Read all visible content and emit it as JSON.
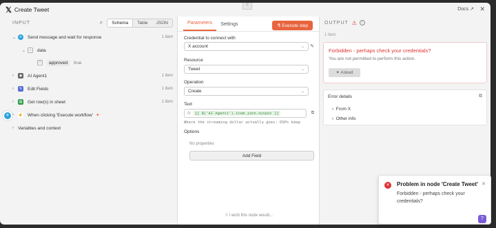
{
  "window": {
    "title": "Create Tweet",
    "docs_label": "Docs ↗",
    "close_icon": "close-icon",
    "drag_handle": "⠿"
  },
  "input": {
    "label": "INPUT",
    "views": [
      "Schema",
      "Table",
      "JSON"
    ],
    "active_view": "Schema",
    "tree": [
      {
        "label": "Send message and wait for response",
        "count": "1 item",
        "color": "#2aa3e0",
        "glyph": "✈"
      },
      {
        "label": "data",
        "color": "#888"
      },
      {
        "label": "approved",
        "value": "true"
      },
      {
        "label": "AI Agent1",
        "count": "1 item",
        "color": "#666",
        "glyph": "◉"
      },
      {
        "label": "Edit Fields",
        "count": "1 item",
        "color": "#5a6fd6",
        "glyph": "✎"
      },
      {
        "label": "Get row(s) in sheet",
        "count": "1 item",
        "color": "#2a9d4a",
        "glyph": "▤"
      },
      {
        "label": "When clicking 'Execute workflow'",
        "extra": "✦"
      },
      {
        "label": "Variables and context"
      }
    ]
  },
  "params": {
    "tabs": [
      "Parameters",
      "Settings"
    ],
    "execute_label": "Execute step",
    "credential_label": "Credential to connect with",
    "credential_value": "X account",
    "resource_label": "Resource",
    "resource_value": "Tweet",
    "operation_label": "Operation",
    "operation_value": "Create",
    "text_label": "Text",
    "text_expr": "{{ $('AI Agent1').item.json.output }}",
    "text_preview": "Where the streaming dollar actually goes: DSPs keep",
    "options_label": "Options",
    "no_props": "No properties",
    "add_field": "Add Field",
    "wish": "I wish this node would..."
  },
  "output": {
    "label": "OUTPUT",
    "count": "1 item",
    "error_title": "Forbidden - perhaps check your credentials?",
    "error_msg": "You are not permitted to perform this action.",
    "asked_label": "Asked",
    "details_label": "Error details",
    "details_rows": [
      "From X",
      "Other info"
    ]
  },
  "toast": {
    "title": "Problem in node 'Create Tweet'",
    "message": "Forbidden - perhaps check your credentials?"
  },
  "colors": {
    "accent": "#e8643f",
    "error": "#dd3333",
    "help": "#7b5cd6"
  }
}
